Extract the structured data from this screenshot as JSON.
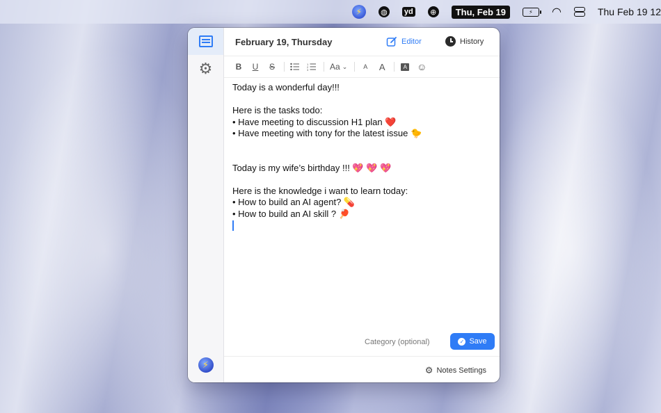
{
  "menubar": {
    "date_badge": "Thu, Feb 19",
    "clock": "Thu Feb 19  12",
    "icons": [
      "app-bolt-icon",
      "globe-icon",
      "yd-icon",
      "network-icon",
      "date-badge",
      "battery-icon",
      "wifi-icon",
      "control-center-icon"
    ]
  },
  "window": {
    "date_title": "February 19, Thursday",
    "tabs": {
      "editor": "Editor",
      "history": "History"
    },
    "toolbar": {
      "bold": "B",
      "underline": "U",
      "strike": "S",
      "font_size": "Aa",
      "small_a": "A",
      "big_a": "A",
      "box_a": "A"
    },
    "editor_lines": [
      "Today is a wonderful day!!!",
      "",
      "Here is the tasks todo:",
      "• Have meeting to discussion H1 plan ❤️",
      "• Have meeting with tony for the latest issue 🐤",
      "",
      "",
      "Today is my wife’s birthday !!!  💖 💖  💖",
      "",
      "Here is the knowledge i want to learn today:",
      "• How to build an AI agent? 💊",
      "• How to build an AI skill ? 🏓"
    ],
    "category_placeholder": "Category (optional)",
    "save_label": "Save",
    "notes_settings_label": "Notes Settings"
  },
  "colors": {
    "accent": "#2f7cf6"
  }
}
